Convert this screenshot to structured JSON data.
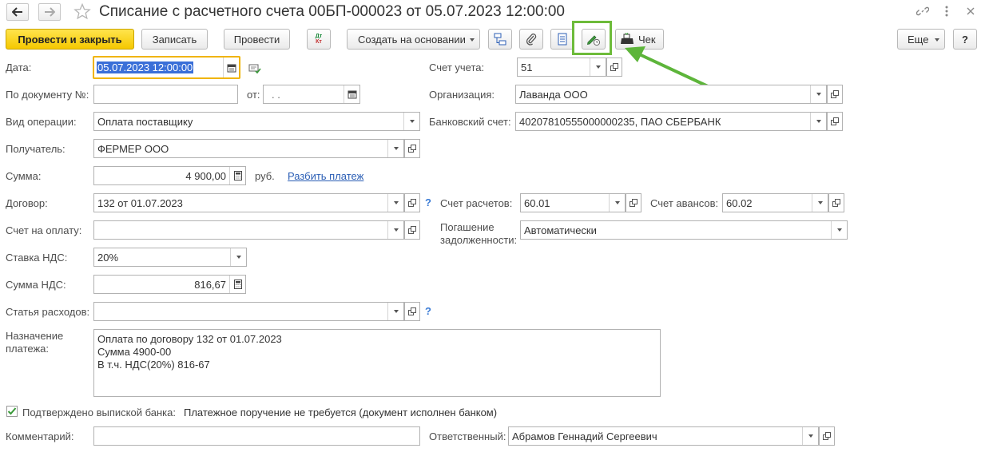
{
  "window": {
    "title": "Списание с расчетного счета 00БП-000023 от 05.07.2023 12:00:00"
  },
  "toolbar": {
    "post_and_close": "Провести и закрыть",
    "save": "Записать",
    "post": "Провести",
    "dtkt_top": "Дт",
    "dtkt_bottom": "Кт",
    "create_based_on": "Создать на основании",
    "receipt": "Чек",
    "more": "Еще",
    "help": "?"
  },
  "form": {
    "date": {
      "label": "Дата:",
      "value": "05.07.2023 12:00:00"
    },
    "doc_number": {
      "label": "По документу №:",
      "value": "",
      "from_label": "от:",
      "from_value": " .  ."
    },
    "operation": {
      "label": "Вид операции:",
      "value": "Оплата поставщику"
    },
    "recipient": {
      "label": "Получатель:",
      "value": "ФЕРМЕР ООО"
    },
    "amount": {
      "label": "Сумма:",
      "value": "4 900,00",
      "currency": "руб.",
      "split_link": "Разбить платеж"
    },
    "contract": {
      "label": "Договор:",
      "value": "132 от 01.07.2023"
    },
    "invoice": {
      "label": "Счет на оплату:",
      "value": ""
    },
    "vat_rate": {
      "label": "Ставка НДС:",
      "value": "20%"
    },
    "vat_amount": {
      "label": "Сумма НДС:",
      "value": "816,67"
    },
    "expense_item": {
      "label": "Статья расходов:",
      "value": ""
    },
    "purpose": {
      "label_line1": "Назначение",
      "label_line2": "платежа:",
      "lines": [
        "Оплата по договору 132 от 01.07.2023",
        "Сумма 4900-00",
        "В т.ч. НДС(20%) 816-67"
      ]
    },
    "confirmed": {
      "label": "Подтверждено выпиской банка:",
      "checked": true,
      "note": "Платежное поручение не требуется (документ исполнен банком)"
    },
    "comment": {
      "label": "Комментарий:",
      "value": ""
    },
    "account": {
      "label": "Счет учета:",
      "value": "51"
    },
    "organization": {
      "label": "Организация:",
      "value": "Лаванда ООО"
    },
    "bank_account": {
      "label": "Банковский счет:",
      "value": "40207810555000000235, ПАО СБЕРБАНК"
    },
    "settlement_account": {
      "label": "Счет расчетов:",
      "value": "60.01"
    },
    "advance_account": {
      "label": "Счет авансов:",
      "value": "60.02"
    },
    "debt_repayment": {
      "label_line1": "Погашение",
      "label_line2": "задолженности:",
      "value": "Автоматически"
    },
    "responsible": {
      "label": "Ответственный:",
      "value": "Абрамов Геннадий Сергеевич"
    }
  },
  "colors": {
    "primary_button": "#f5c800",
    "highlight_frame": "#6dbb3a",
    "arrow": "#5db53a",
    "link": "#2b5eb5",
    "focus_border": "#f0b400"
  }
}
